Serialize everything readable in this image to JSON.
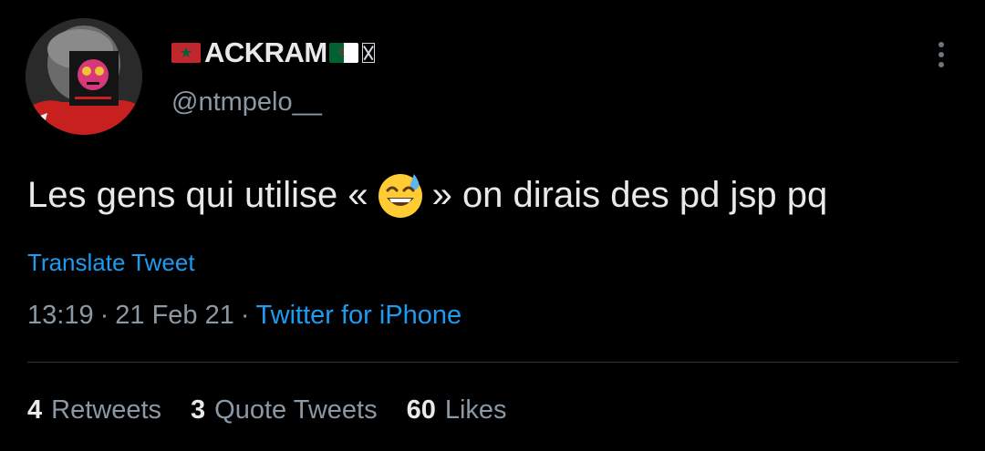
{
  "author": {
    "display_name": "ACKRAM",
    "handle": "@ntmpelo__",
    "flags": [
      "morocco-flag",
      "algeria-flag"
    ]
  },
  "tweet": {
    "text_before": "Les gens qui utilise «",
    "emoji": "grinning-face-with-sweat",
    "text_after": "» on dirais des pd jsp pq",
    "translate_label": "Translate Tweet",
    "time": "13:19",
    "separator": "·",
    "date": "21 Feb 21",
    "source": "Twitter for iPhone"
  },
  "stats": [
    {
      "count": "4",
      "label": "Retweets"
    },
    {
      "count": "3",
      "label": "Quote Tweets"
    },
    {
      "count": "60",
      "label": "Likes"
    }
  ],
  "colors": {
    "background": "#000000",
    "text": "#e7e9ea",
    "secondary": "#8b98a5",
    "accent": "#1d9bf0",
    "divider": "#2f3336"
  },
  "icons": {
    "more": "more-vertical-icon"
  }
}
